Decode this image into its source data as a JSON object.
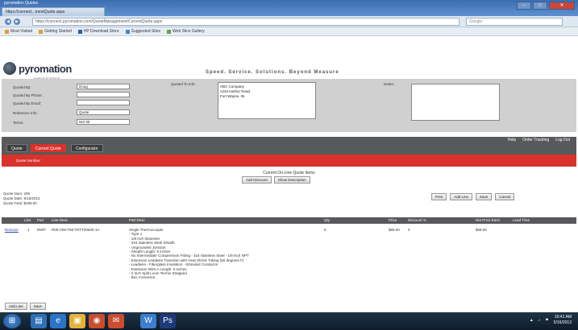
{
  "browser": {
    "tabs": [
      "pyromation Quotes",
      "https://connect...mentQuote.aspx"
    ],
    "url": "https://connect.pyromation.com/QuoteManagement/CurrentQuote.aspx",
    "search_placeholder": "Google",
    "bookmarks": [
      "Most Visited",
      "Getting Started",
      "HP Download Store",
      "Suggested Sites",
      "Web Slice Gallery"
    ]
  },
  "header": {
    "logo": "pyromation",
    "logo_sub": "EARTH SCIENCE",
    "tagline": "Speed. Service. Solutions.  Beyond Measure"
  },
  "quote_form": {
    "quoted_by_label": "Quoted By:",
    "quoted_by_value": "Doug",
    "quoted_by_phone_label": "Quoted By Phone:",
    "quoted_by_phone_value": "",
    "quoted_by_email_label": "Quoted By Email:",
    "quoted_by_email_value": "",
    "reference_info_label": "Reference Info:",
    "reference_info_value": "Quote",
    "terms_label": "Terms:",
    "terms_value": "Net 30",
    "quoted_to_label": "Quoted To Info:",
    "quoted_to_value": "ABC Company\n1234 Harbor Road\nFort Wayne, IN",
    "notes_label": "Notes:",
    "notes_value": ""
  },
  "top_links": [
    "Help",
    "Order Tracking",
    "Log Out"
  ],
  "page_tabs": [
    "Quote",
    "Current Quote",
    "Configurator"
  ],
  "breadcrumb": "Quote Number:",
  "center": {
    "title": "Current On-Line Quote Items",
    "buttons": [
      "Add Discount",
      "Show Description"
    ]
  },
  "summary": {
    "lines": [
      "Quote Num:  205",
      "Quote Date:  5/16/2013",
      "Quote Total:  $295.00"
    ]
  },
  "actions": [
    "Print",
    "Add Line",
    "Save",
    "Cancel"
  ],
  "grid": {
    "headers": [
      "Line",
      "Part",
      "Line Desc",
      "Part Desc",
      "Qty",
      "Price",
      "Discount %",
      "Net Price Each",
      "Lead Time"
    ],
    "rows": [
      {
        "action": "Remove",
        "line": "1",
        "part": "R50T",
        "line_desc": "R00-V09-T08-TRTT00625-1A",
        "part_desc": "Single Thermocouple\n- Type J\n- 1/8 Inch Diameter\n- 316 Stainless Steel Sheath\n- Ungrounded Junction\n- Sheath Length: 6 inches\n- No Intermediate Compression Fitting - 316 Stainless Steel - 1/8 inch NPT\n- Extension Leadwire Transition with Heat Shrink Tubing (50 degrees F)\n- Leadwire - Fiberglass Insulation - Stranded Conductor\n- Extension Wire-A Length: 6 inches\n- 2 Inch Split Loom Termin Strapped\n- Bus Connector",
        "qty": "5",
        "price": "$59.00",
        "discount": "0",
        "net_each": "$59.00",
        "lead_time": ""
      }
    ]
  },
  "bottom_buttons": [
    "Add Line",
    "Save"
  ],
  "taskbar": {
    "time": "10:41 AM",
    "date": "5/16/2013"
  }
}
